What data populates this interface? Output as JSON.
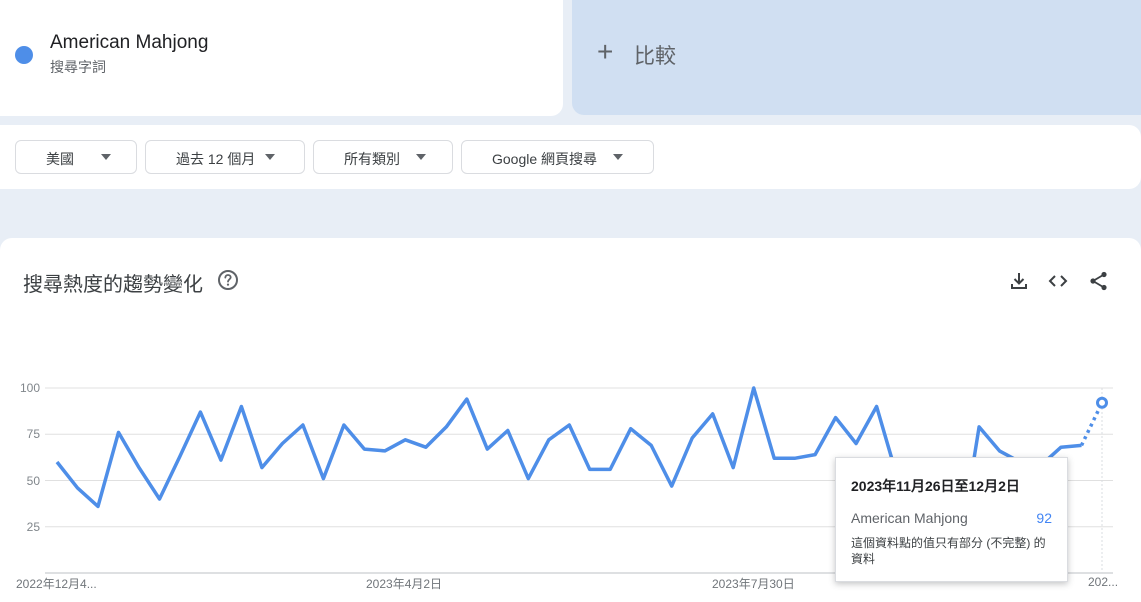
{
  "search_term": {
    "name": "American Mahjong",
    "subtitle": "搜尋字詞",
    "color": "#4e8ee8"
  },
  "compare": {
    "plus": "+",
    "label": "比較"
  },
  "filters": {
    "region": "美國",
    "period": "過去 12 個月",
    "category": "所有類別",
    "property": "Google 網頁搜尋"
  },
  "chart_header": {
    "title": "搜尋熱度的趨勢變化",
    "help_icon": "question-circle-icon",
    "download_icon": "download-icon",
    "embed_icon": "code-icon",
    "share_icon": "share-icon"
  },
  "chart_data": {
    "type": "line",
    "y_ticks": [
      "100",
      "75",
      "50",
      "25"
    ],
    "ylim": [
      0,
      100
    ],
    "x_tick_labels": [
      "2022年12月4...",
      "2023年4月2日",
      "2023年7月30日",
      "202..."
    ],
    "grid": true,
    "series": [
      {
        "name": "American Mahjong",
        "color": "#4e8ee8",
        "values": [
          60,
          46,
          36,
          76,
          57,
          40,
          63,
          87,
          61,
          90,
          57,
          70,
          80,
          51,
          80,
          67,
          66,
          72,
          68,
          79,
          94,
          67,
          77,
          51,
          72,
          80,
          56,
          56,
          78,
          69,
          47,
          73,
          86,
          57,
          100,
          62,
          62,
          64,
          84,
          70,
          90,
          52,
          39,
          56,
          10,
          79,
          66,
          60,
          58,
          68,
          69,
          92
        ],
        "partial_last": true
      }
    ]
  },
  "tooltip": {
    "date": "2023年11月26日至12月2日",
    "term": "American Mahjong",
    "value": "92",
    "note": "這個資料點的值只有部分 (不完整) 的資料"
  }
}
